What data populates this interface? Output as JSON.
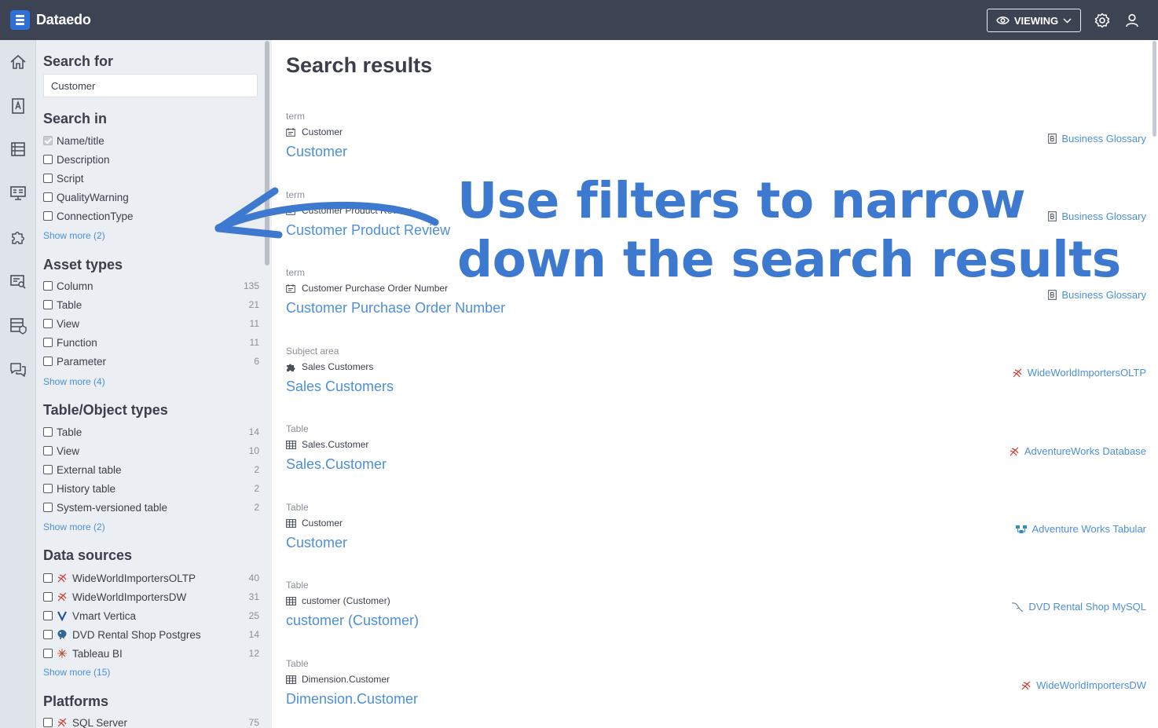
{
  "app": {
    "name": "Dataedo"
  },
  "topbar": {
    "mode_label": "VIEWING"
  },
  "filters": {
    "search_for": {
      "title": "Search for",
      "value": "Customer"
    },
    "search_in": {
      "title": "Search in",
      "items": [
        {
          "label": "Name/title",
          "checked": true
        },
        {
          "label": "Description"
        },
        {
          "label": "Script"
        },
        {
          "label": "QualityWarning"
        },
        {
          "label": "ConnectionType"
        }
      ],
      "show_more": "Show more (2)"
    },
    "asset_types": {
      "title": "Asset types",
      "items": [
        {
          "label": "Column",
          "count": "135"
        },
        {
          "label": "Table",
          "count": "21"
        },
        {
          "label": "View",
          "count": "11"
        },
        {
          "label": "Function",
          "count": "11"
        },
        {
          "label": "Parameter",
          "count": "6"
        }
      ],
      "show_more": "Show more (4)"
    },
    "object_types": {
      "title": "Table/Object types",
      "items": [
        {
          "label": "Table",
          "count": "14"
        },
        {
          "label": "View",
          "count": "10"
        },
        {
          "label": "External table",
          "count": "2"
        },
        {
          "label": "History table",
          "count": "2"
        },
        {
          "label": "System-versioned table",
          "count": "2"
        }
      ],
      "show_more": "Show more (2)"
    },
    "data_sources": {
      "title": "Data sources",
      "items": [
        {
          "label": "WideWorldImportersOLTP",
          "count": "40",
          "icon": "sql-server-icon"
        },
        {
          "label": "WideWorldImportersDW",
          "count": "31",
          "icon": "sql-server-icon"
        },
        {
          "label": "Vmart Vertica",
          "count": "25",
          "icon": "vertica-icon"
        },
        {
          "label": "DVD Rental Shop Postgres",
          "count": "14",
          "icon": "postgres-icon"
        },
        {
          "label": "Tableau BI",
          "count": "12",
          "icon": "tableau-icon"
        }
      ],
      "show_more": "Show more (15)"
    },
    "platforms": {
      "title": "Platforms",
      "items": [
        {
          "label": "SQL Server",
          "count": "75",
          "icon": "sql-server-icon"
        }
      ]
    }
  },
  "main": {
    "title": "Search results",
    "results": [
      {
        "type": "term",
        "path": "Customer",
        "path_icon": "glossary-term-icon",
        "name": "Customer",
        "source": "Business Glossary",
        "source_icon": "glossary-icon"
      },
      {
        "type": "term",
        "path": "Customer Product Review",
        "path_icon": "glossary-term-icon",
        "name": "Customer Product Review",
        "source": "Business Glossary",
        "source_icon": "glossary-icon"
      },
      {
        "type": "term",
        "path": "Customer Purchase Order Number",
        "path_icon": "glossary-term-icon",
        "name": "Customer Purchase Order Number",
        "source": "Business Glossary",
        "source_icon": "glossary-icon"
      },
      {
        "type": "Subject area",
        "path": "Sales Customers",
        "path_icon": "puzzle-icon",
        "name": "Sales Customers",
        "source": "WideWorldImportersOLTP",
        "source_icon": "sql-server-icon"
      },
      {
        "type": "Table",
        "path": "Sales.Customer",
        "path_icon": "table-icon",
        "name": "Sales.Customer",
        "source": "AdventureWorks Database",
        "source_icon": "sql-server-icon"
      },
      {
        "type": "Table",
        "path": "Customer",
        "path_icon": "table-icon",
        "name": "Customer",
        "source": "Adventure Works Tabular",
        "source_icon": "tabular-icon"
      },
      {
        "type": "Table",
        "path": "customer (Customer)",
        "path_icon": "table-icon",
        "name": "customer (Customer)",
        "source": "DVD Rental Shop MySQL",
        "source_icon": "mysql-icon"
      },
      {
        "type": "Table",
        "path": "Dimension.Customer",
        "path_icon": "table-icon",
        "name": "Dimension.Customer",
        "source": "WideWorldImportersDW",
        "source_icon": "sql-server-icon"
      }
    ]
  },
  "annotation": {
    "line1": "Use filters to narrow",
    "line2": "down the search results"
  },
  "colors": {
    "topbar": "#3c4454",
    "accent": "#4d8fd8",
    "annotation": "#3d79cf"
  }
}
